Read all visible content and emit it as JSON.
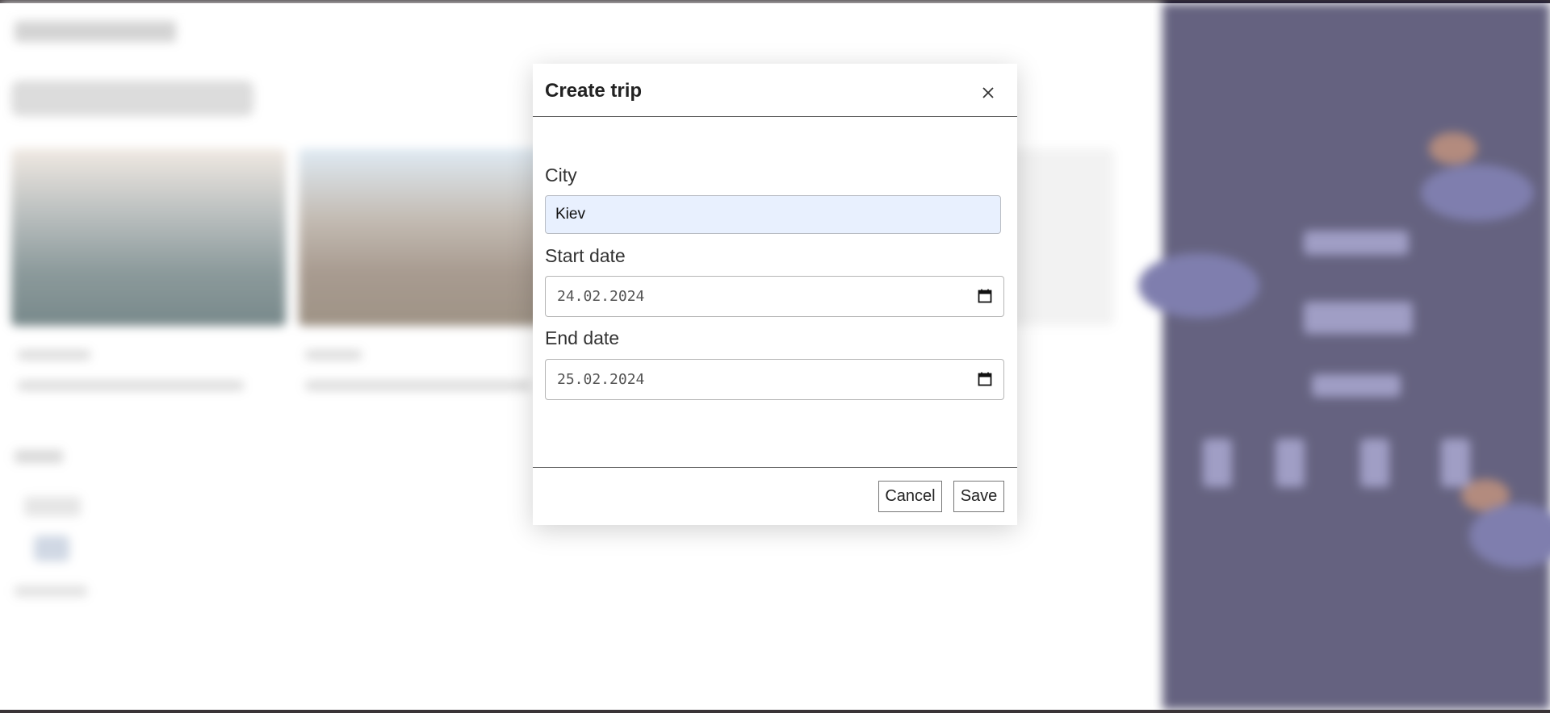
{
  "modal": {
    "title": "Create trip",
    "city": {
      "label": "City",
      "value": "Kiev"
    },
    "start_date": {
      "label": "Start date",
      "value": "24.02.2024"
    },
    "end_date": {
      "label": "End date",
      "value": "25.02.2024"
    },
    "buttons": {
      "cancel": "Cancel",
      "save": "Save"
    }
  },
  "icons": {
    "close": "close-icon",
    "calendar": "calendar-icon"
  },
  "colors": {
    "sidebar_background": "#130f3c",
    "autofill_background": "#e8f0fe"
  }
}
